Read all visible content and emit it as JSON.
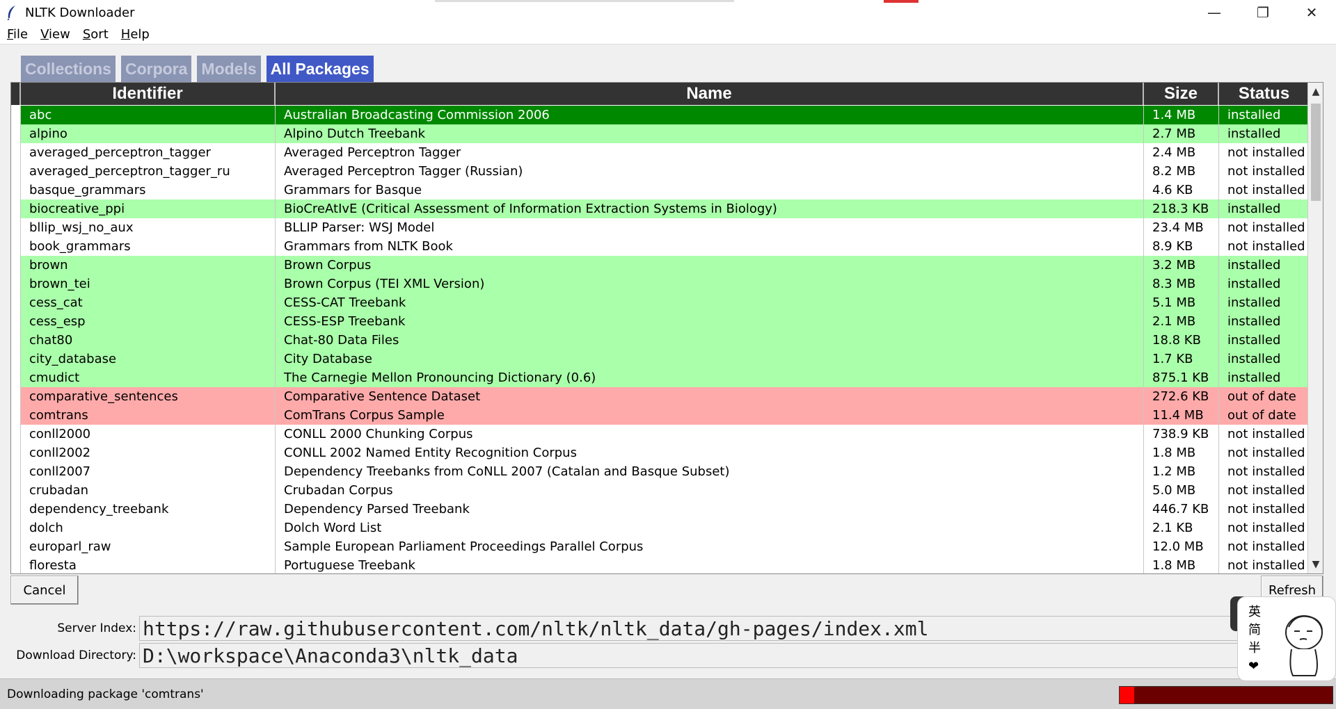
{
  "window": {
    "title": "NLTK Downloader",
    "minimize": "—",
    "maximize": "❐",
    "close": "✕"
  },
  "menu": {
    "file": "File",
    "view": "View",
    "sort": "Sort",
    "help": "Help"
  },
  "tabs": [
    "Collections",
    "Corpora",
    "Models",
    "All Packages"
  ],
  "active_tab": "All Packages",
  "table": {
    "headers": {
      "identifier": "Identifier",
      "name": "Name",
      "size": "Size",
      "status": "Status"
    },
    "rows": [
      {
        "id": "abc",
        "name": "Australian Broadcasting Commission 2006",
        "size": "1.4 MB",
        "status": "installed",
        "state": "selected"
      },
      {
        "id": "alpino",
        "name": "Alpino Dutch Treebank",
        "size": "2.7 MB",
        "status": "installed",
        "state": "installed"
      },
      {
        "id": "averaged_perceptron_tagger",
        "name": "Averaged Perceptron Tagger",
        "size": "2.4 MB",
        "status": "not installed",
        "state": "notinstalled"
      },
      {
        "id": "averaged_perceptron_tagger_ru",
        "name": "Averaged Perceptron Tagger (Russian)",
        "size": "8.2 MB",
        "status": "not installed",
        "state": "notinstalled"
      },
      {
        "id": "basque_grammars",
        "name": "Grammars for Basque",
        "size": "4.6 KB",
        "status": "not installed",
        "state": "notinstalled"
      },
      {
        "id": "biocreative_ppi",
        "name": "BioCreAtIvE (Critical Assessment of Information Extraction Systems in Biology)",
        "size": "218.3 KB",
        "status": "installed",
        "state": "installed"
      },
      {
        "id": "bllip_wsj_no_aux",
        "name": "BLLIP Parser: WSJ Model",
        "size": "23.4 MB",
        "status": "not installed",
        "state": "notinstalled"
      },
      {
        "id": "book_grammars",
        "name": "Grammars from NLTK Book",
        "size": "8.9 KB",
        "status": "not installed",
        "state": "notinstalled"
      },
      {
        "id": "brown",
        "name": "Brown Corpus",
        "size": "3.2 MB",
        "status": "installed",
        "state": "installed"
      },
      {
        "id": "brown_tei",
        "name": "Brown Corpus (TEI XML Version)",
        "size": "8.3 MB",
        "status": "installed",
        "state": "installed"
      },
      {
        "id": "cess_cat",
        "name": "CESS-CAT Treebank",
        "size": "5.1 MB",
        "status": "installed",
        "state": "installed"
      },
      {
        "id": "cess_esp",
        "name": "CESS-ESP Treebank",
        "size": "2.1 MB",
        "status": "installed",
        "state": "installed"
      },
      {
        "id": "chat80",
        "name": "Chat-80 Data Files",
        "size": "18.8 KB",
        "status": "installed",
        "state": "installed"
      },
      {
        "id": "city_database",
        "name": "City Database",
        "size": "1.7 KB",
        "status": "installed",
        "state": "installed"
      },
      {
        "id": "cmudict",
        "name": "The Carnegie Mellon Pronouncing Dictionary (0.6)",
        "size": "875.1 KB",
        "status": "installed",
        "state": "installed"
      },
      {
        "id": "comparative_sentences",
        "name": "Comparative Sentence Dataset",
        "size": "272.6 KB",
        "status": "out of date",
        "state": "outdated"
      },
      {
        "id": "comtrans",
        "name": "ComTrans Corpus Sample",
        "size": "11.4 MB",
        "status": "out of date",
        "state": "outdated"
      },
      {
        "id": "conll2000",
        "name": "CONLL 2000 Chunking Corpus",
        "size": "738.9 KB",
        "status": "not installed",
        "state": "notinstalled"
      },
      {
        "id": "conll2002",
        "name": "CONLL 2002 Named Entity Recognition Corpus",
        "size": "1.8 MB",
        "status": "not installed",
        "state": "notinstalled"
      },
      {
        "id": "conll2007",
        "name": "Dependency Treebanks from CoNLL 2007 (Catalan and Basque Subset)",
        "size": "1.2 MB",
        "status": "not installed",
        "state": "notinstalled"
      },
      {
        "id": "crubadan",
        "name": "Crubadan Corpus",
        "size": "5.0 MB",
        "status": "not installed",
        "state": "notinstalled"
      },
      {
        "id": "dependency_treebank",
        "name": "Dependency Parsed Treebank",
        "size": "446.7 KB",
        "status": "not installed",
        "state": "notinstalled"
      },
      {
        "id": "dolch",
        "name": "Dolch Word List",
        "size": "2.1 KB",
        "status": "not installed",
        "state": "notinstalled"
      },
      {
        "id": "europarl_raw",
        "name": "Sample European Parliament Proceedings Parallel Corpus",
        "size": "12.0 MB",
        "status": "not installed",
        "state": "notinstalled"
      },
      {
        "id": "floresta",
        "name": "Portuguese Treebank",
        "size": "1.8 MB",
        "status": "not installed",
        "state": "notinstalled"
      }
    ]
  },
  "buttons": {
    "cancel": "Cancel",
    "refresh": "Refresh"
  },
  "fields": {
    "server_index_label": "Server Index:",
    "server_index_value": "https://raw.githubusercontent.com/nltk/nltk_data/gh-pages/index.xml",
    "download_dir_label": "Download Directory:",
    "download_dir_value": "D:\\workspace\\Anaconda3\\nltk_data"
  },
  "status": {
    "text": "Downloading package 'comtrans'",
    "progress": 0.07
  },
  "ime": {
    "chars": [
      "英",
      "简",
      "半",
      "❤"
    ]
  },
  "colors": {
    "installed": "#aaffaa",
    "outdated": "#ffaaaa",
    "selected": "#008800",
    "tab_active": "#4159c6",
    "progress_fill": "#ff0000",
    "progress_bg": "#6a0000"
  }
}
